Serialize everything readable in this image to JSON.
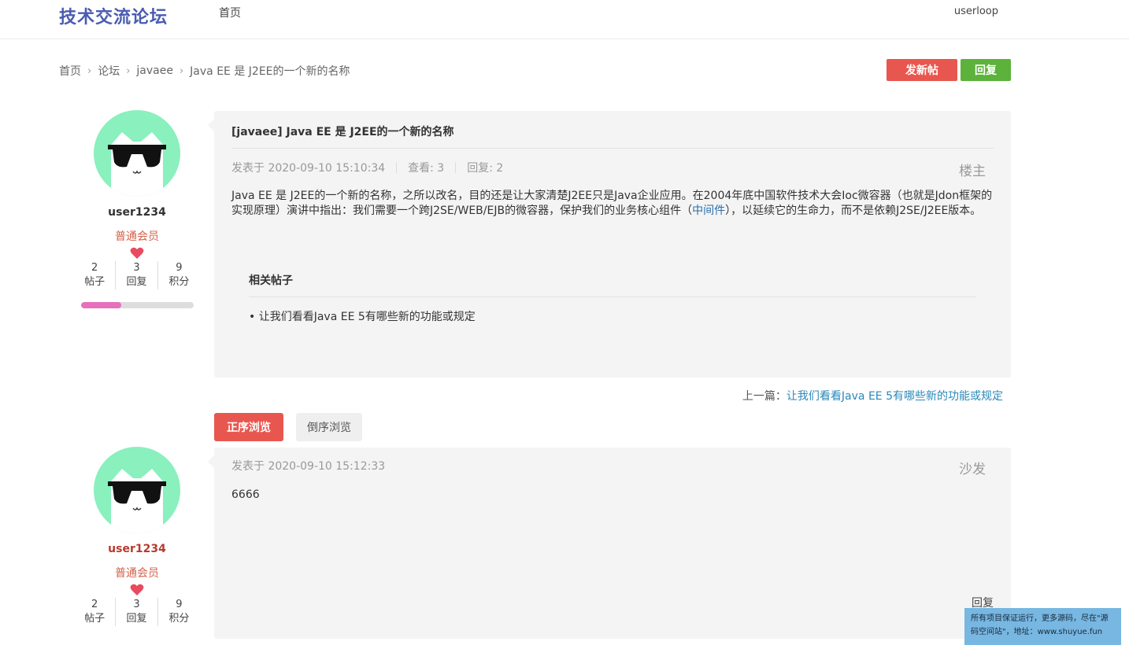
{
  "header": {
    "logo": "技术交流论坛",
    "nav_home": "首页",
    "user": "userloop"
  },
  "breadcrumb": {
    "items": [
      "首页",
      "论坛",
      "javaee",
      "Java EE 是 J2EE的一个新的名称"
    ],
    "separator": "›"
  },
  "actions": {
    "new_post": "发新帖",
    "reply": "回复"
  },
  "thread": {
    "title": "[javaee] Java EE 是 J2EE的一个新的名称",
    "posted_at": "发表于 2020-09-10 15:10:34",
    "views": "查看: 3",
    "replies": "回复: 2",
    "floor": "楼主",
    "body_part1": "Java EE 是 J2EE的一个新的名称，之所以改名，目的还是让大家清楚J2EE只是Java企业应用。在2004年底中国软件技术大会Ioc微容器（也就是Jdon框架的实现原理）演讲中指出：我们需要一个跨J2SE/WEB/EJB的微容器，保护我们的业务核心组件（",
    "body_link": "中间件",
    "body_part2": "），以延续它的生命力，而不是依赖J2SE/J2EE版本。",
    "related_title": "相关帖子",
    "related_items": [
      "• 让我们看看Java EE 5有哪些新的功能或规定"
    ]
  },
  "author_op": {
    "username": "user1234",
    "level": "普通会员",
    "stats": [
      {
        "value": "2",
        "label": "帖子"
      },
      {
        "value": "3",
        "label": "回复"
      },
      {
        "value": "9",
        "label": "积分"
      }
    ],
    "progress": 0.36
  },
  "prev_nav": {
    "label": "上一篇：",
    "link": "让我们看看Java EE 5有哪些新的功能或规定"
  },
  "sort": {
    "asc": "正序浏览",
    "desc": "倒序浏览"
  },
  "reply1": {
    "posted_at": "发表于 2020-09-10 15:12:33",
    "floor": "沙发",
    "body": "6666",
    "reply_link": "回复"
  },
  "author_reply": {
    "username": "user1234",
    "level": "普通会员",
    "stats": [
      {
        "value": "2",
        "label": "帖子"
      },
      {
        "value": "3",
        "label": "回复"
      },
      {
        "value": "9",
        "label": "积分"
      }
    ]
  },
  "watermark": {
    "text": "所有项目保证运行，更多源码，尽在\"源码空间站\"，地址：www.shuyue.fun"
  },
  "colors": {
    "brand": "#4a5bb0",
    "new_post_btn": "#e8574f",
    "reply_btn": "#5cb23a",
    "avatar_bg": "#8af0bd",
    "progress": "#e76fbd"
  }
}
